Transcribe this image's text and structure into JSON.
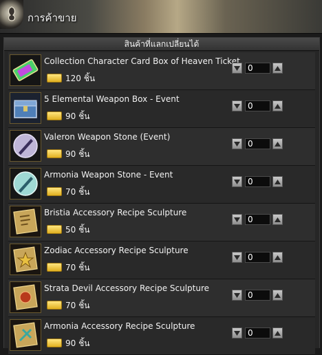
{
  "window": {
    "title": "การค้าขาย",
    "emblem_icon": "emblem-icon"
  },
  "panel": {
    "header": "สินค้าที่แลกเปลี่ยนได้"
  },
  "items": [
    {
      "name": "Collection Character Card Box of Heaven Ticket",
      "price": "120 ชิ้น",
      "qty": "0",
      "icon": "card-ticket-icon"
    },
    {
      "name": "5 Elemental Weapon Box - Event",
      "price": "90 ชิ้น",
      "qty": "0",
      "icon": "chest-box-icon"
    },
    {
      "name": "Valeron Weapon Stone (Event)",
      "price": "90 ชิ้น",
      "qty": "0",
      "icon": "weapon-stone-icon"
    },
    {
      "name": "Armonia Weapon Stone - Event",
      "price": "70 ชิ้น",
      "qty": "0",
      "icon": "weapon-stone-icon"
    },
    {
      "name": "Bristia Accessory Recipe Sculpture",
      "price": "50 ชิ้น",
      "qty": "0",
      "icon": "recipe-scroll-icon"
    },
    {
      "name": "Zodiac Accessory Recipe Sculpture",
      "price": "70 ชิ้น",
      "qty": "0",
      "icon": "recipe-scroll-icon"
    },
    {
      "name": "Strata Devil Accessory Recipe Sculpture",
      "price": "70 ชิ้น",
      "qty": "0",
      "icon": "recipe-scroll-icon"
    },
    {
      "name": "Armonia Accessory Recipe Sculpture",
      "price": "90 ชิ้น",
      "qty": "0",
      "icon": "recipe-scroll-icon"
    }
  ],
  "colors": {
    "accent_gold": "#e0b020",
    "panel_bg": "#262626"
  }
}
